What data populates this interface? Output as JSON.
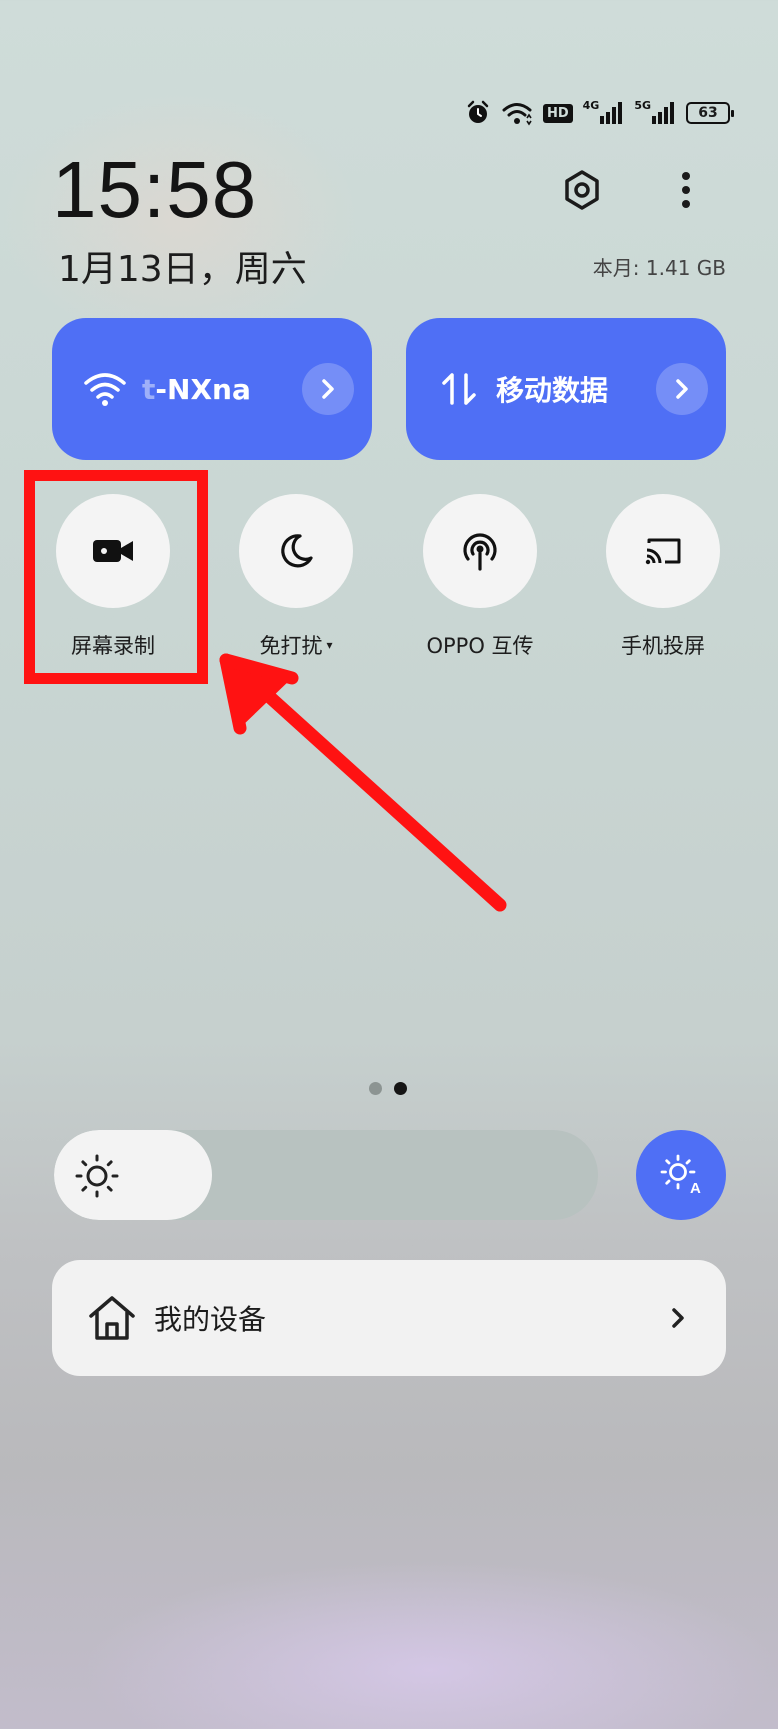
{
  "status_bar": {
    "icons": [
      "alarm-icon",
      "wifi-icon",
      "hd-icon",
      "signal-4g-icon",
      "signal-5g-icon"
    ],
    "hd_label": "HD",
    "net_4g": "4G",
    "net_5g": "5G",
    "battery": "63"
  },
  "header": {
    "time": "15:58",
    "date": "1月13日，周六",
    "data_usage": "本月: 1.41 GB",
    "settings_icon": "gear-icon",
    "more_icon": "more-vertical-icon"
  },
  "big_tiles": {
    "wifi": {
      "label_dim": "t",
      "label": "-NXna",
      "icon": "wifi-icon",
      "chevron": "chevron-right-icon"
    },
    "mobile": {
      "label": "移动数据",
      "icon": "data-arrows-icon",
      "chevron": "chevron-right-icon"
    }
  },
  "toggles": [
    {
      "label": "屏幕录制",
      "icon": "video-camera-icon"
    },
    {
      "label": "免打扰",
      "icon": "moon-icon",
      "caret": "▾"
    },
    {
      "label": "OPPO 互传",
      "icon": "antenna-icon"
    },
    {
      "label": "手机投屏",
      "icon": "cast-icon"
    }
  ],
  "pager": {
    "current": 2,
    "total": 2
  },
  "brightness": {
    "level": 0.29,
    "auto_icon": "auto-brightness-icon",
    "icon": "sun-icon"
  },
  "devices": {
    "label": "我的设备",
    "icon": "home-icon",
    "chevron": "chevron-right-icon"
  },
  "colors": {
    "accent": "#4f6ff5",
    "highlight": "#ff1212",
    "tile_bg": "#f4f4f4"
  }
}
